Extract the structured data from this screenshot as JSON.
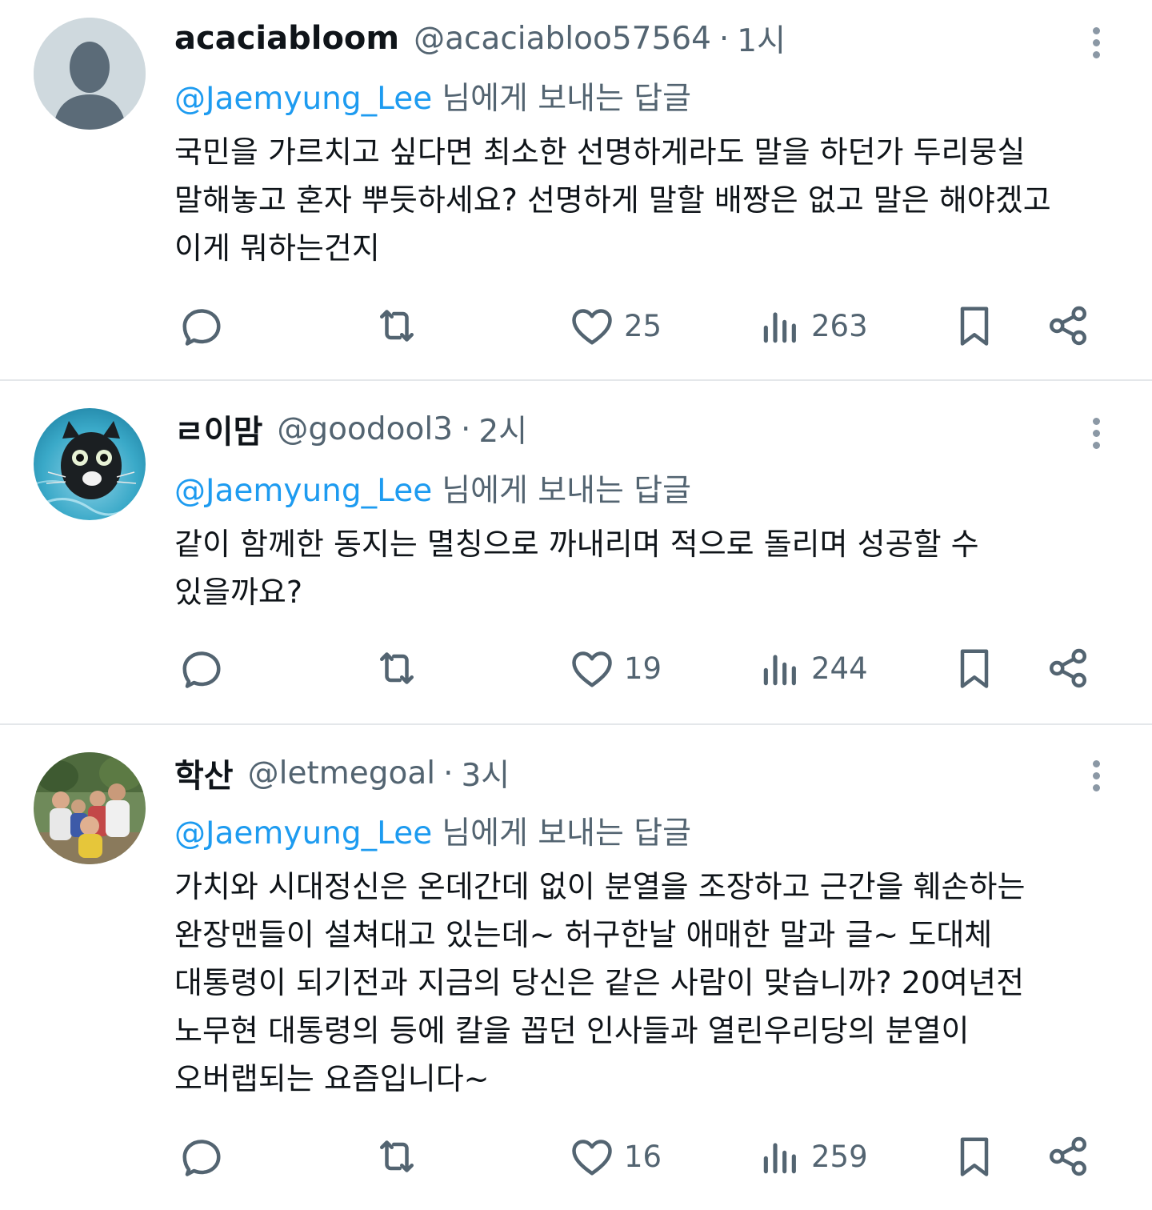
{
  "tweets": [
    {
      "display_name": "acaciabloom",
      "handle": "@acaciabloo57564",
      "separator": "·",
      "time": "1시",
      "reply_mention": "@Jaemyung_Lee",
      "reply_suffix": "님에게 보내는 답글",
      "lines": [
        "국민을 가르치고 싶다면 최소한 선명하게라도 말을 하던가 두리뭉실",
        "말해놓고 혼자 뿌듯하세요? 선명하게 말할 배짱은 없고 말은 해야겠고",
        "이게 뭐하는건지"
      ],
      "likes": "25",
      "views": "263",
      "avatar": "default-silhouette"
    },
    {
      "display_name": "ㄹ이맘",
      "handle": "@goodool3",
      "separator": "·",
      "time": "2시",
      "reply_mention": "@Jaemyung_Lee",
      "reply_suffix": "님에게 보내는 답글",
      "lines": [
        "같이 함께한 동지는 멸칭으로 까내리며 적으로 돌리며 성공할 수",
        "있을까요?"
      ],
      "likes": "19",
      "views": "244",
      "avatar": "cat-underwater-photo"
    },
    {
      "display_name": "학산",
      "handle": "@letmegoal",
      "separator": "·",
      "time": "3시",
      "reply_mention": "@Jaemyung_Lee",
      "reply_suffix": "님에게 보내는 답글",
      "lines": [
        "가치와 시대정신은 온데간데 없이 분열을 조장하고 근간을 훼손하는",
        "완장맨들이 설쳐대고 있는데~ 허구한날 애매한 말과 글~ 도대체",
        "대통령이 되기전과 지금의 당신은 같은 사람이 맞습니까? 20여년전",
        "노무현 대통령의 등에 칼을 꼽던 인사들과 열린우리당의 분열이",
        "오버랩되는 요즘입니다~"
      ],
      "likes": "16",
      "views": "259",
      "avatar": "family-photo"
    }
  ],
  "colors": {
    "text": "#0f1419",
    "secondary": "#536471",
    "link": "#1d9bf0",
    "divider": "#e4e7ea"
  },
  "icons": [
    "reply-icon",
    "retweet-icon",
    "like-icon",
    "views-icon",
    "bookmark-icon",
    "share-icon",
    "more-icon"
  ]
}
